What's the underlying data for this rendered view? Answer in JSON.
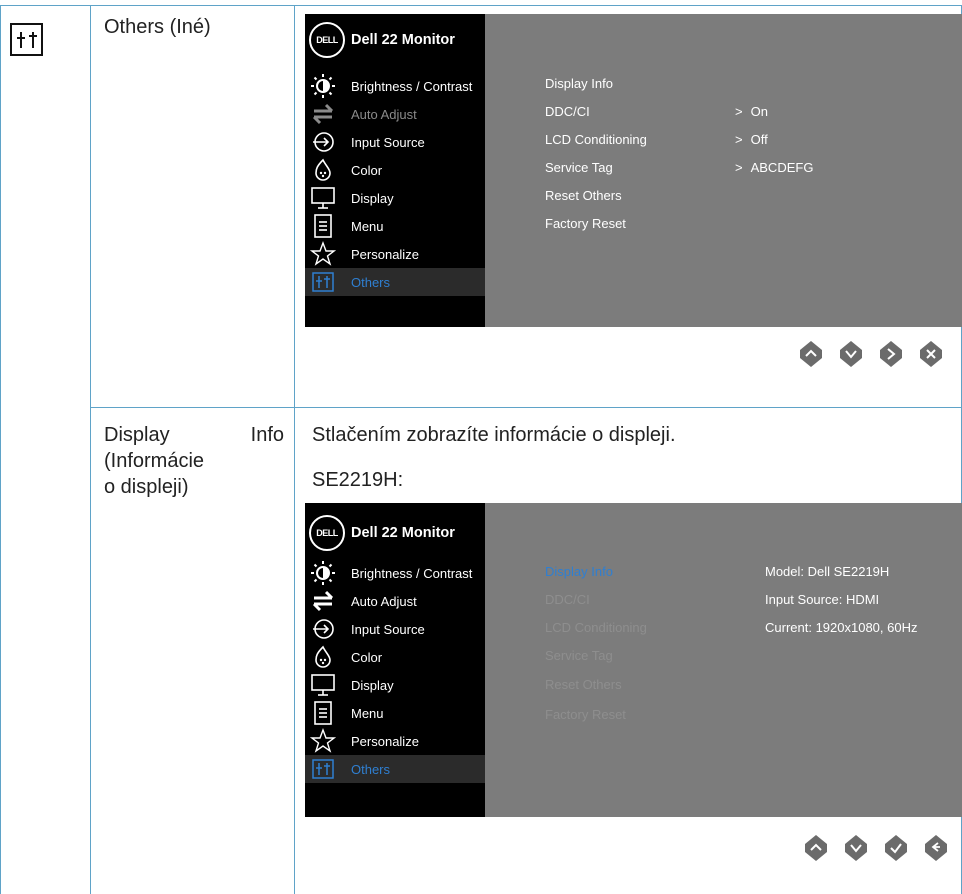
{
  "rows": [
    {
      "label": "Others (Iné)",
      "osd": {
        "title": "Dell 22 Monitor",
        "logo": "DELL",
        "menu": [
          {
            "label": "Brightness / Contrast",
            "icon": "brightness-icon",
            "state": "normal"
          },
          {
            "label": "Auto Adjust",
            "icon": "auto-adjust-icon",
            "state": "dim"
          },
          {
            "label": "Input Source",
            "icon": "input-source-icon",
            "state": "normal"
          },
          {
            "label": "Color",
            "icon": "color-icon",
            "state": "normal"
          },
          {
            "label": "Display",
            "icon": "display-icon",
            "state": "normal"
          },
          {
            "label": "Menu",
            "icon": "menu-icon",
            "state": "normal"
          },
          {
            "label": "Personalize",
            "icon": "star-icon",
            "state": "normal"
          },
          {
            "label": "Others",
            "icon": "others-icon",
            "state": "selected"
          }
        ],
        "submenu": [
          "Display Info",
          "DDC/CI",
          "LCD Conditioning",
          "Service Tag",
          "Reset Others",
          "Factory Reset"
        ],
        "values": [
          {
            "text": "On",
            "arrow": ">"
          },
          {
            "text": "Off",
            "arrow": ">"
          },
          {
            "text": "ABCDEFG",
            "arrow": ">"
          }
        ],
        "buttons": [
          "up-button",
          "down-button",
          "right-button",
          "close-button"
        ]
      }
    },
    {
      "label": "Display Info (Informácie o displeji)",
      "description": "Stlačením zobrazíte informácie o displeji.",
      "model_heading": "SE2219H:",
      "osd": {
        "title": "Dell 22 Monitor",
        "logo": "DELL",
        "menu": [
          {
            "label": "Brightness / Contrast",
            "icon": "brightness-icon",
            "state": "normal"
          },
          {
            "label": "Auto Adjust",
            "icon": "auto-adjust-icon",
            "state": "normal"
          },
          {
            "label": "Input Source",
            "icon": "input-source-icon",
            "state": "normal"
          },
          {
            "label": "Color",
            "icon": "color-icon",
            "state": "normal"
          },
          {
            "label": "Display",
            "icon": "display-icon",
            "state": "normal"
          },
          {
            "label": "Menu",
            "icon": "menu-icon",
            "state": "normal"
          },
          {
            "label": "Personalize",
            "icon": "star-icon",
            "state": "normal"
          },
          {
            "label": "Others",
            "icon": "others-icon",
            "state": "selected"
          }
        ],
        "submenu": [
          "Display Info",
          "DDC/CI",
          "LCD Conditioning",
          "Service Tag",
          "Reset Others",
          "Factory Reset"
        ],
        "info": [
          "Model: Dell SE2219H",
          "Input Source: HDMI",
          "Current: 1920x1080, 60Hz"
        ],
        "buttons": [
          "up-button",
          "down-button",
          "check-button",
          "back-button"
        ]
      }
    }
  ],
  "colors": {
    "grid": "#5fa3c8",
    "osd_black": "#000000",
    "osd_gray": "#7c7c7c",
    "highlight": "#2f7fd1"
  }
}
